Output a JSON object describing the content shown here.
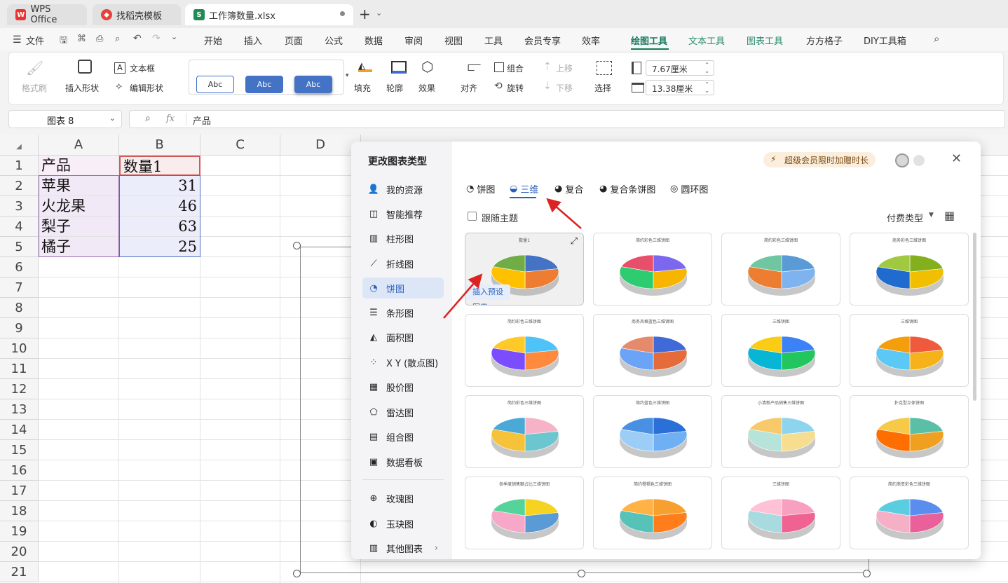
{
  "tabs": [
    {
      "label": "WPS Office"
    },
    {
      "label": "找稻壳模板"
    },
    {
      "label": "工作簿数量.xlsx"
    }
  ],
  "menu": {
    "file": "文件",
    "items": [
      "开始",
      "插入",
      "页面",
      "公式",
      "数据",
      "审阅",
      "视图",
      "工具",
      "会员专享",
      "效率",
      "绘图工具",
      "文本工具",
      "图表工具",
      "方方格子",
      "DIY工具箱"
    ],
    "active": "绘图工具"
  },
  "ribbon": {
    "format_brush": "格式刷",
    "insert_shape": "插入形状",
    "text_box": "文本框",
    "edit_shape": "编辑形状",
    "style_sample": "Abc",
    "fill": "填充",
    "outline": "轮廓",
    "effect": "效果",
    "align": "对齐",
    "group": "组合",
    "rotate": "旋转",
    "move_up": "上移",
    "move_down": "下移",
    "select": "选择",
    "height": "7.67厘米",
    "width": "13.38厘米"
  },
  "formula_bar": {
    "name_box": "图表 8",
    "fx": "fx",
    "content": "产品"
  },
  "sheet": {
    "columns": [
      "A",
      "B",
      "C",
      "D"
    ],
    "rows": [
      "1",
      "2",
      "3",
      "4",
      "5",
      "6",
      "7",
      "8",
      "9",
      "10",
      "11",
      "12",
      "13",
      "14",
      "15",
      "16",
      "17",
      "18",
      "19",
      "20",
      "21"
    ],
    "cells": [
      [
        "产品",
        "数量1"
      ],
      [
        "苹果",
        "31"
      ],
      [
        "火龙果",
        "46"
      ],
      [
        "梨子",
        "63"
      ],
      [
        "橘子",
        "25"
      ]
    ]
  },
  "dialog": {
    "title": "更改图表类型",
    "promo": "超级会员限时加赠时长",
    "sidebar": [
      "我的资源",
      "智能推荐",
      "柱形图",
      "折线图",
      "饼图",
      "条形图",
      "面积图",
      "X Y (散点图)",
      "股价图",
      "雷达图",
      "组合图",
      "数据看板",
      "玫瑰图",
      "玉玦图",
      "其他图表"
    ],
    "selected_sidebar": "饼图",
    "subtabs": [
      "饼图",
      "三维",
      "复合",
      "复合条饼图",
      "圆环图"
    ],
    "selected_subtab": "三维",
    "follow_theme": "跟随主题",
    "paid_type": "付费类型",
    "insert_preset": "插入预设图表",
    "cards": [
      {
        "title": "数量1"
      },
      {
        "title": "简约彩色三维饼图"
      },
      {
        "title": "简约彩色三维饼图"
      },
      {
        "title": "商务彩色三维饼图"
      },
      {
        "title": "简约彩色三维饼图"
      },
      {
        "title": "商务风格蓝色三维饼图"
      },
      {
        "title": "三维饼图"
      },
      {
        "title": "三维饼图"
      },
      {
        "title": "简约彩色三维饼图"
      },
      {
        "title": "简约蓝色三维饼图"
      },
      {
        "title": "小清新产品销售三维饼图"
      },
      {
        "title": "扑克型立体饼图"
      },
      {
        "title": "各季度销售额占比三维饼图"
      },
      {
        "title": "简约橙褐色三维饼图"
      },
      {
        "title": "三维饼图"
      },
      {
        "title": "简约渐变彩色三维饼图"
      }
    ]
  }
}
